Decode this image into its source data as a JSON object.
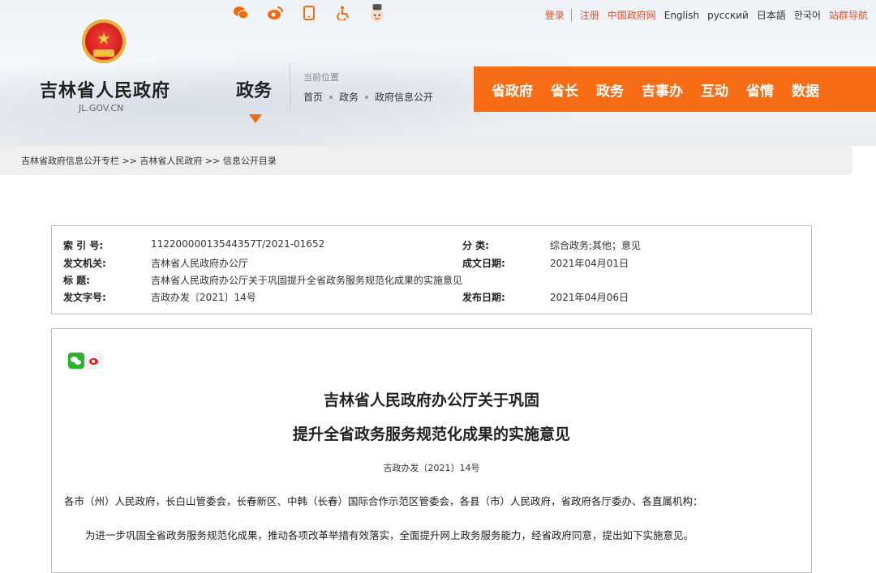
{
  "top": {
    "icons": [
      "wechat-icon",
      "weibo-icon",
      "mobile-icon",
      "accessibility-icon",
      "mascot-icon"
    ],
    "links": {
      "login": "登录",
      "register": "注册",
      "gov_cn": "中国政府网",
      "english": "English",
      "russian": "русский",
      "japanese": "日本語",
      "korean": "한국어",
      "site_nav": "站群导航"
    }
  },
  "header": {
    "site_name": "吉林省人民政府",
    "site_url": "JL.GOV.CN",
    "section": "政务",
    "location_label": "当前位置",
    "location": [
      "首页",
      "政务",
      "政府信息公开"
    ]
  },
  "nav": [
    "省政府",
    "省长",
    "政务",
    "吉事办",
    "互动",
    "省情",
    "数据"
  ],
  "breadcrumb": "吉林省政府信息公开专栏 >> 吉林省人民政府 >> 信息公开目录",
  "info": {
    "index_label": "索 引 号:",
    "index_value": "11220000013544357T/2021-01652",
    "category_label": "分 类:",
    "category_value": "综合政务;其他；意见",
    "issuer_label": "发文机关:",
    "issuer_value": "吉林省人民政府办公厅",
    "date_label": "成文日期:",
    "date_value": "2021年04月01日",
    "title_label": "标 题:",
    "title_value": "吉林省人民政府办公厅关于巩固提升全省政务服务规范化成果的实施意见",
    "docno_label": "发文字号:",
    "docno_value": "吉政办发〔2021〕14号",
    "pubdate_label": "发布日期:",
    "pubdate_value": "2021年04月06日"
  },
  "article": {
    "title_line1": "吉林省人民政府办公厅关于巩固",
    "title_line2": "提升全省政务服务规范化成果的实施意见",
    "doc_number": "吉政办发〔2021〕14号",
    "para1": "各市（州）人民政府，长白山管委会，长春新区、中韩（长春）国际合作示范区管委会，各县（市）人民政府，省政府各厅委办、各直属机构：",
    "para2": "为进一步巩固全省政务服务规范化成果，推动各项改革举措有效落实，全面提升网上政务服务能力，经省政府同意，提出如下实施意见。"
  }
}
